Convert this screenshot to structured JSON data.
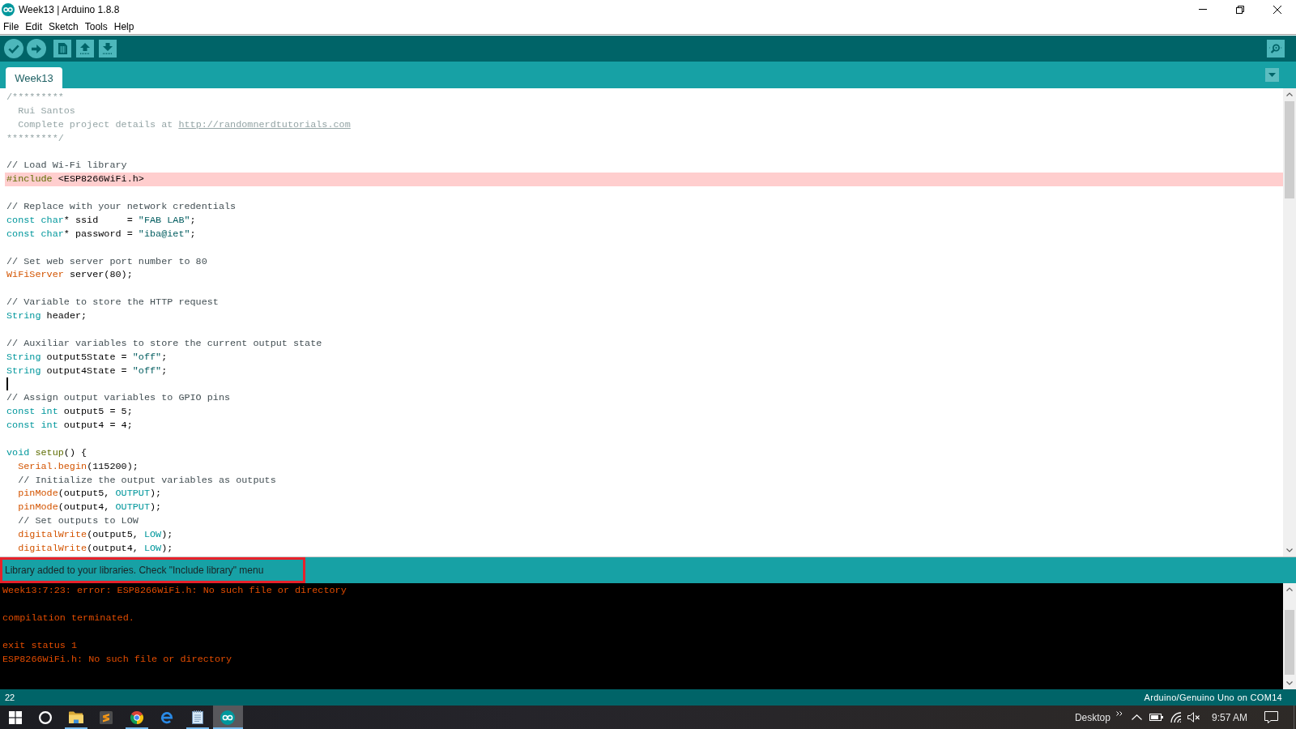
{
  "window": {
    "title": "Week13 | Arduino 1.8.8"
  },
  "menu": [
    "File",
    "Edit",
    "Sketch",
    "Tools",
    "Help"
  ],
  "tabs": [
    {
      "label": "Week13",
      "selected": true
    }
  ],
  "editor": {
    "lines": [
      {
        "tokens": [
          {
            "kind": "doc-comment",
            "text": "/*********"
          }
        ],
        "highlighted": false,
        "cursor": false
      },
      {
        "tokens": [
          {
            "kind": "doc-comment",
            "text": "  Rui Santos"
          }
        ],
        "highlighted": false,
        "cursor": false
      },
      {
        "tokens": [
          {
            "kind": "doc-comment",
            "text": "  Complete project details at "
          },
          {
            "kind": "link",
            "text": "http://randomnerdtutorials.com"
          }
        ],
        "highlighted": false,
        "cursor": false
      },
      {
        "tokens": [
          {
            "kind": "doc-comment",
            "text": "*********/"
          }
        ],
        "highlighted": false,
        "cursor": false
      },
      {
        "highlighted": false,
        "cursor": false
      },
      {
        "tokens": [
          {
            "kind": "comment",
            "text": "// Load Wi-Fi library"
          }
        ],
        "highlighted": false,
        "cursor": false
      },
      {
        "tokens": [
          {
            "kind": "directive",
            "text": "#include"
          },
          {
            "kind": "plain",
            "text": " <ESP8266WiFi.h>"
          }
        ],
        "highlighted": true,
        "cursor": false
      },
      {
        "highlighted": false,
        "cursor": false
      },
      {
        "tokens": [
          {
            "kind": "comment",
            "text": "// Replace with your network credentials"
          }
        ],
        "highlighted": false,
        "cursor": false
      },
      {
        "tokens": [
          {
            "kind": "keyword",
            "text": "const char"
          },
          {
            "kind": "plain",
            "text": "* ssid     = "
          },
          {
            "kind": "string",
            "text": "\"FAB LAB\""
          },
          {
            "kind": "plain",
            "text": ";"
          }
        ],
        "highlighted": false,
        "cursor": false
      },
      {
        "tokens": [
          {
            "kind": "keyword",
            "text": "const char"
          },
          {
            "kind": "plain",
            "text": "* password = "
          },
          {
            "kind": "string",
            "text": "\"iba@iet\""
          },
          {
            "kind": "plain",
            "text": ";"
          }
        ],
        "highlighted": false,
        "cursor": false
      },
      {
        "highlighted": false,
        "cursor": false
      },
      {
        "tokens": [
          {
            "kind": "comment",
            "text": "// Set web server port number to 80"
          }
        ],
        "highlighted": false,
        "cursor": false
      },
      {
        "tokens": [
          {
            "kind": "function",
            "text": "WiFiServer"
          },
          {
            "kind": "plain",
            "text": " server(80);"
          }
        ],
        "highlighted": false,
        "cursor": false
      },
      {
        "highlighted": false,
        "cursor": false
      },
      {
        "tokens": [
          {
            "kind": "comment",
            "text": "// Variable to store the HTTP request"
          }
        ],
        "highlighted": false,
        "cursor": false
      },
      {
        "tokens": [
          {
            "kind": "keyword",
            "text": "String"
          },
          {
            "kind": "plain",
            "text": " header;"
          }
        ],
        "highlighted": false,
        "cursor": false
      },
      {
        "highlighted": false,
        "cursor": false
      },
      {
        "tokens": [
          {
            "kind": "comment",
            "text": "// Auxiliar variables to store the current output state"
          }
        ],
        "highlighted": false,
        "cursor": false
      },
      {
        "tokens": [
          {
            "kind": "keyword",
            "text": "String"
          },
          {
            "kind": "plain",
            "text": " output5State = "
          },
          {
            "kind": "string",
            "text": "\"off\""
          },
          {
            "kind": "plain",
            "text": ";"
          }
        ],
        "highlighted": false,
        "cursor": false
      },
      {
        "tokens": [
          {
            "kind": "keyword",
            "text": "String"
          },
          {
            "kind": "plain",
            "text": " output4State = "
          },
          {
            "kind": "string",
            "text": "\"off\""
          },
          {
            "kind": "plain",
            "text": ";"
          }
        ],
        "highlighted": false,
        "cursor": false
      },
      {
        "highlighted": false,
        "cursor": true
      },
      {
        "tokens": [
          {
            "kind": "comment",
            "text": "// Assign output variables to GPIO pins"
          }
        ],
        "highlighted": false,
        "cursor": false
      },
      {
        "tokens": [
          {
            "kind": "keyword",
            "text": "const int"
          },
          {
            "kind": "plain",
            "text": " output5 = 5;"
          }
        ],
        "highlighted": false,
        "cursor": false
      },
      {
        "tokens": [
          {
            "kind": "keyword",
            "text": "const int"
          },
          {
            "kind": "plain",
            "text": " output4 = 4;"
          }
        ],
        "highlighted": false,
        "cursor": false
      },
      {
        "highlighted": false,
        "cursor": false
      },
      {
        "tokens": [
          {
            "kind": "keyword",
            "text": "void "
          },
          {
            "kind": "directive",
            "text": "setup"
          },
          {
            "kind": "plain",
            "text": "() {"
          }
        ],
        "highlighted": false,
        "cursor": false
      },
      {
        "tokens": [
          {
            "kind": "function",
            "text": "  Serial.begin"
          },
          {
            "kind": "plain",
            "text": "(115200);"
          }
        ],
        "highlighted": false,
        "cursor": false
      },
      {
        "tokens": [
          {
            "kind": "comment",
            "text": "  // Initialize the output variables as outputs"
          }
        ],
        "highlighted": false,
        "cursor": false
      },
      {
        "tokens": [
          {
            "kind": "function",
            "text": "  pinMode"
          },
          {
            "kind": "plain",
            "text": "(output5, "
          },
          {
            "kind": "keyword",
            "text": "OUTPUT"
          },
          {
            "kind": "plain",
            "text": ");"
          }
        ],
        "highlighted": false,
        "cursor": false
      },
      {
        "tokens": [
          {
            "kind": "function",
            "text": "  pinMode"
          },
          {
            "kind": "plain",
            "text": "(output4, "
          },
          {
            "kind": "keyword",
            "text": "OUTPUT"
          },
          {
            "kind": "plain",
            "text": ");"
          }
        ],
        "highlighted": false,
        "cursor": false
      },
      {
        "tokens": [
          {
            "kind": "comment",
            "text": "  // Set outputs to LOW"
          }
        ],
        "highlighted": false,
        "cursor": false
      },
      {
        "tokens": [
          {
            "kind": "function",
            "text": "  digitalWrite"
          },
          {
            "kind": "plain",
            "text": "(output5, "
          },
          {
            "kind": "keyword",
            "text": "LOW"
          },
          {
            "kind": "plain",
            "text": ");"
          }
        ],
        "highlighted": false,
        "cursor": false
      },
      {
        "tokens": [
          {
            "kind": "function",
            "text": "  digitalWrite"
          },
          {
            "kind": "plain",
            "text": "(output4, "
          },
          {
            "kind": "keyword",
            "text": "LOW"
          },
          {
            "kind": "plain",
            "text": ");"
          }
        ],
        "highlighted": false,
        "cursor": false
      }
    ]
  },
  "message_bar": {
    "text": "Library added to your libraries. Check \"Include library\" menu",
    "annotated": true
  },
  "console": {
    "groups": [
      [
        "Week13:7:23: error: ESP8266WiFi.h: No such file or directory"
      ],
      [
        "compilation terminated."
      ],
      [
        "exit status 1",
        "ESP8266WiFi.h: No such file or directory"
      ]
    ]
  },
  "status_bar": {
    "line": "22",
    "board": "Arduino/Genuino Uno on COM14"
  },
  "taskbar": {
    "apps": [
      {
        "running": true,
        "selected": false
      },
      {
        "running": false,
        "selected": false
      },
      {
        "running": true,
        "selected": false
      },
      {
        "running": false,
        "selected": false
      },
      {
        "running": true,
        "selected": false
      },
      {
        "running": true,
        "selected": true
      }
    ]
  },
  "tray": {
    "toolbar_label": "Desktop",
    "muted": true,
    "time": "9:57 AM"
  }
}
